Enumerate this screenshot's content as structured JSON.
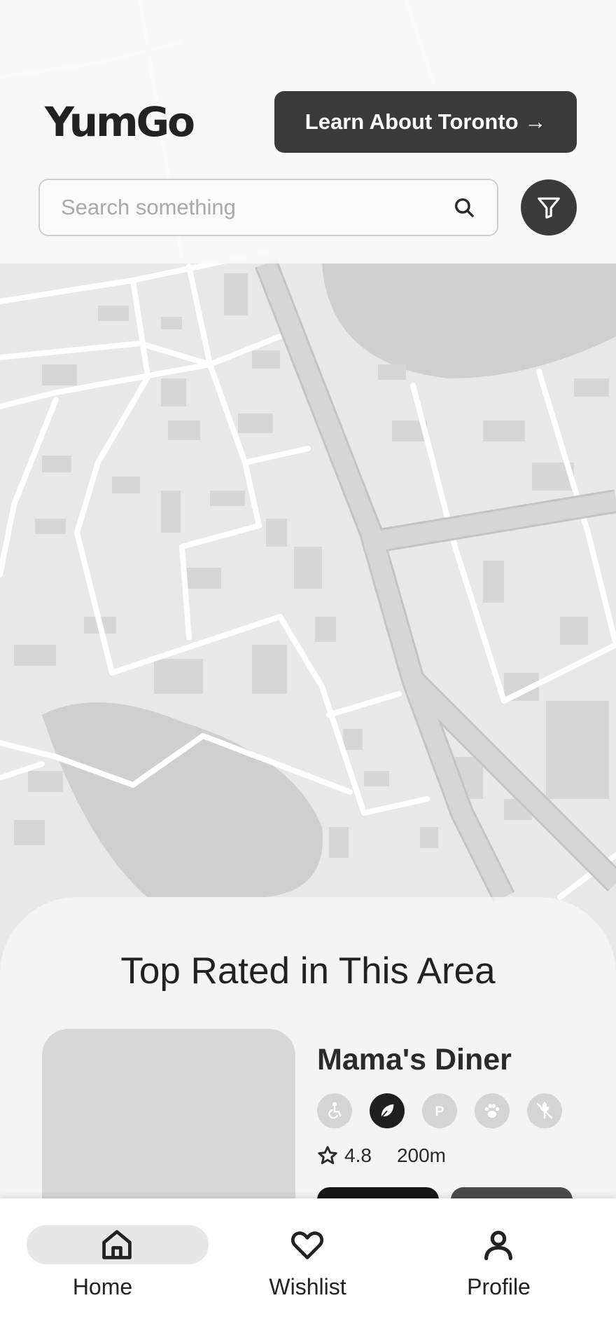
{
  "app": {
    "logo": "YumGo"
  },
  "header": {
    "learn_button": "Learn About Toronto →"
  },
  "search": {
    "placeholder": "Search something"
  },
  "icons": {
    "search": "search-icon",
    "filter": "filter-icon"
  },
  "section": {
    "title": "Top Rated in This Area"
  },
  "restaurant": {
    "name": "Mama's Diner",
    "rating": "4.8",
    "distance": "200m",
    "amenities": [
      {
        "icon": "wheelchair-icon",
        "active": false
      },
      {
        "icon": "leaf-icon",
        "active": true
      },
      {
        "icon": "parking-icon",
        "active": false
      },
      {
        "icon": "paw-icon",
        "active": false
      },
      {
        "icon": "gluten-free-icon",
        "active": false
      }
    ]
  },
  "nav": {
    "items": [
      {
        "label": "Home",
        "icon": "home-icon",
        "active": true
      },
      {
        "label": "Wishlist",
        "icon": "heart-icon",
        "active": false
      },
      {
        "label": "Profile",
        "icon": "user-icon",
        "active": false
      }
    ]
  },
  "colors": {
    "dark": "#3a3a3a",
    "map": "#e6e6e6",
    "water": "#cccccc",
    "road": "#ffffff"
  }
}
